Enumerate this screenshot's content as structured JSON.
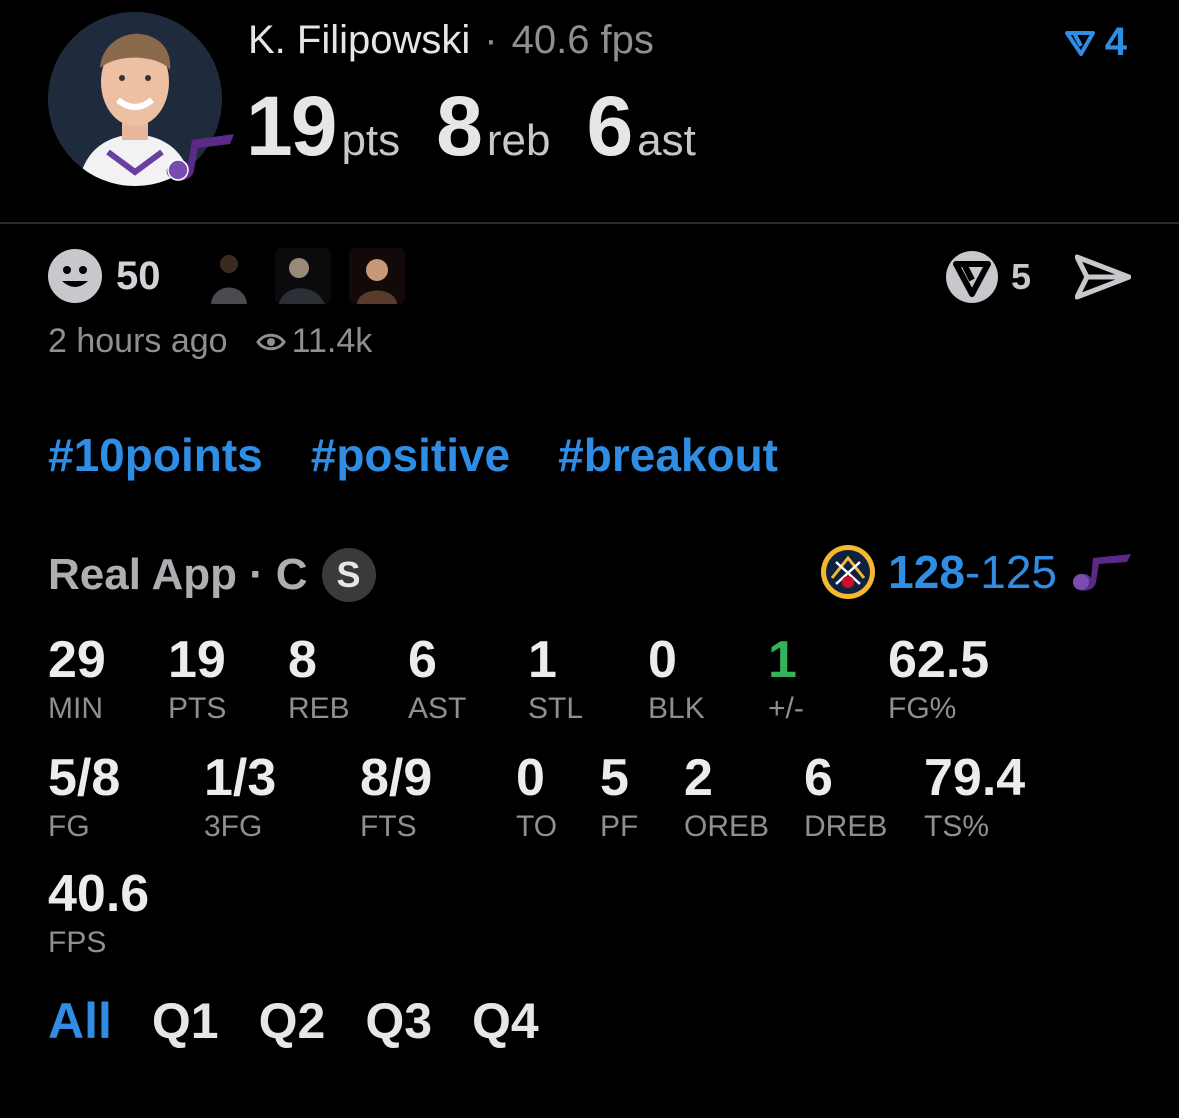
{
  "header": {
    "player_name": "K. Filipowski",
    "separator": "·",
    "fps_text": "40.6 fps",
    "points": "19",
    "points_unit": "pts",
    "rebounds": "8",
    "rebounds_unit": "reb",
    "assists": "6",
    "assists_unit": "ast",
    "badge_count": "4",
    "avatar_icon": "player-headshot",
    "team_logo": "jazz-note-logo"
  },
  "reactions": {
    "count": "50",
    "icon": "smiley-icon",
    "thumbnails": [
      "reaction-thumb-1",
      "reaction-thumb-2",
      "reaction-thumb-3"
    ],
    "vote_count": "5",
    "vote_icon": "vote-shield-icon",
    "share_icon": "send-icon"
  },
  "meta": {
    "time_ago": "2 hours ago",
    "views": "11.4k",
    "views_icon": "eye-icon"
  },
  "tags": [
    "#10points",
    "#positive",
    "#breakout"
  ],
  "box": {
    "source": "Real App",
    "dot": "·",
    "position": "C",
    "badge": "S",
    "score_win": "128",
    "score_dash": "-",
    "score_lose": "125",
    "team_left_logo": "nuggets-logo",
    "team_right_logo": "jazz-note-logo"
  },
  "stats_row1": [
    {
      "value": "29",
      "label": "MIN"
    },
    {
      "value": "19",
      "label": "PTS"
    },
    {
      "value": "8",
      "label": "REB"
    },
    {
      "value": "6",
      "label": "AST"
    },
    {
      "value": "1",
      "label": "STL"
    },
    {
      "value": "0",
      "label": "BLK"
    },
    {
      "value": "1",
      "label": "+/-"
    },
    {
      "value": "62.5",
      "label": "FG%"
    }
  ],
  "stats_row2": [
    {
      "value": "5/8",
      "label": "FG"
    },
    {
      "value": "1/3",
      "label": "3FG"
    },
    {
      "value": "8/9",
      "label": "FTS"
    },
    {
      "value": "0",
      "label": "TO"
    },
    {
      "value": "5",
      "label": "PF"
    },
    {
      "value": "2",
      "label": "OREB"
    },
    {
      "value": "6",
      "label": "DREB"
    },
    {
      "value": "79.4",
      "label": "TS%"
    }
  ],
  "stats_row3": [
    {
      "value": "40.6",
      "label": "FPS"
    }
  ],
  "quarters": [
    "All",
    "Q1",
    "Q2",
    "Q3",
    "Q4"
  ],
  "colors": {
    "accent": "#2f8de4",
    "positive": "#34b35a",
    "jazz_purple": "#5b2a86"
  }
}
